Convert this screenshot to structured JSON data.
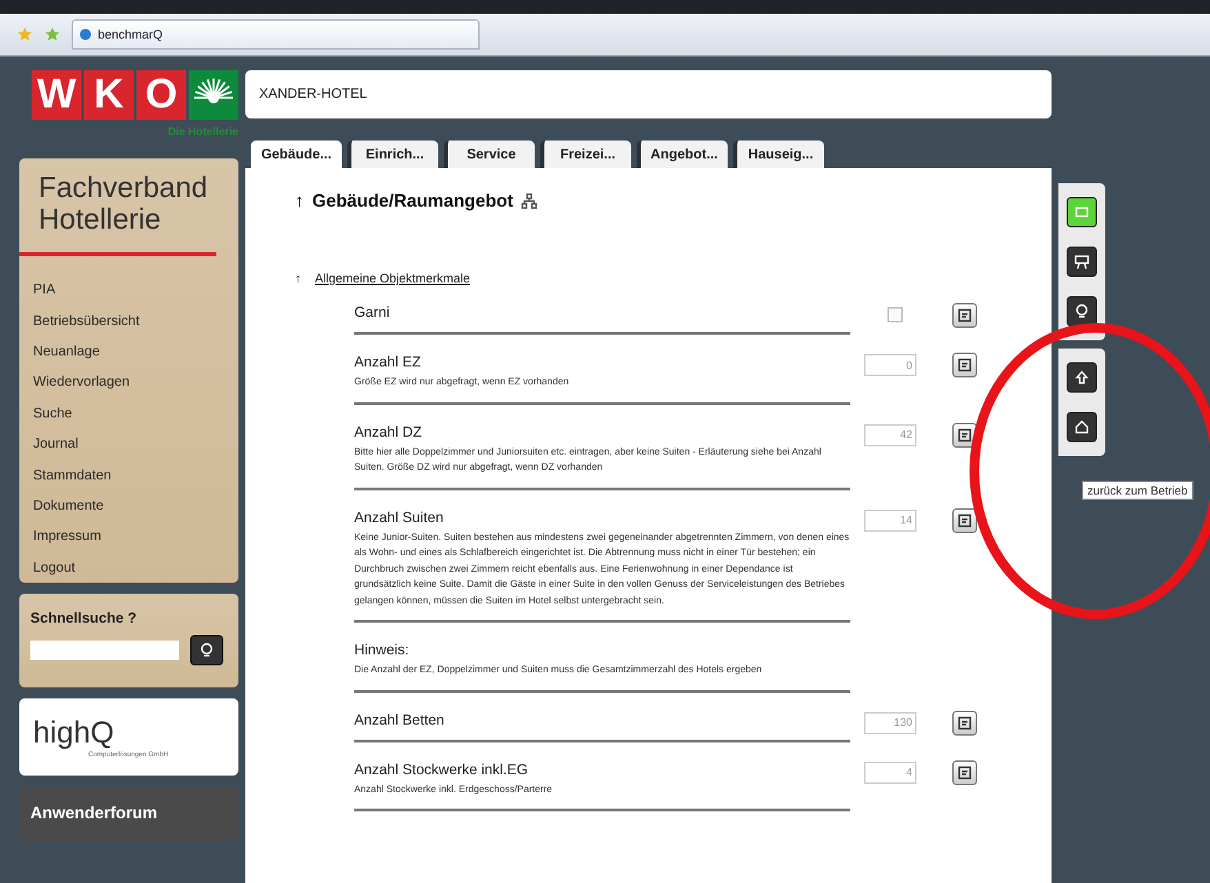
{
  "browser": {
    "tab_title": "benchmarQ"
  },
  "logo": {
    "letters": [
      "W",
      "K",
      "O"
    ],
    "subtitle": "Die Hotellerie"
  },
  "sidebar": {
    "title": "Fachverband Hotellerie",
    "items": [
      {
        "label": "PIA"
      },
      {
        "label": "Betriebsübersicht"
      },
      {
        "label": "Neuanlage"
      },
      {
        "label": "Wiedervorlagen"
      },
      {
        "label": "Suche"
      },
      {
        "label": "Journal"
      },
      {
        "label": "Stammdaten"
      },
      {
        "label": "Dokumente"
      },
      {
        "label": "Impressum"
      },
      {
        "label": "Logout"
      }
    ]
  },
  "quick_search": {
    "label": "Schnellsuche ?"
  },
  "partner": {
    "name": "highQ",
    "tagline": "Computerlösungen GmbH"
  },
  "forum": {
    "label": "Anwenderforum"
  },
  "header": {
    "title": "XANDER-HOTEL"
  },
  "tabs": [
    {
      "label": "Gebäude...",
      "selected": true
    },
    {
      "label": "Einrich...",
      "selected": false
    },
    {
      "label": "Service",
      "selected": false
    },
    {
      "label": "Freizei...",
      "selected": false
    },
    {
      "label": "Angebot...",
      "selected": false
    },
    {
      "label": "Hauseig...",
      "selected": false
    }
  ],
  "content": {
    "arrow": "↑",
    "title": "Gebäude/Raumangebot",
    "section": {
      "arrow": "↑",
      "title": "Allgemeine Objektmerkmale"
    },
    "rows": [
      {
        "kind": "checkbox",
        "label": "Garni",
        "checked": false
      },
      {
        "kind": "number",
        "label": "Anzahl EZ",
        "note": "Größe EZ wird nur abgefragt, wenn EZ vorhanden",
        "value": "0"
      },
      {
        "kind": "number",
        "label": "Anzahl DZ",
        "note": "Bitte hier alle Doppelzimmer und Juniorsuiten etc. eintragen, aber keine Suiten - Erläuterung siehe bei Anzahl Suiten. Größe DZ wird nur abgefragt, wenn DZ vorhanden",
        "value": "42"
      },
      {
        "kind": "number",
        "label": "Anzahl Suiten",
        "note": "Keine Junior-Suiten. Suiten bestehen aus mindestens zwei gegeneinander abgetrennten Zimmern, von denen eines als Wohn- und eines als Schlafbereich eingerichtet ist. Die Abtrennung muss nicht in einer Tür bestehen; ein Durchbruch zwischen zwei Zimmern reicht ebenfalls aus. Eine Ferienwohnung in einer Dependance ist grundsätzlich keine Suite. Damit die Gäste in einer Suite in den vollen Genuss der Serviceleistungen des Betriebes gelangen können, müssen die Suiten im Hotel selbst untergebracht sein.",
        "value": "14"
      },
      {
        "kind": "note",
        "label": "Hinweis:",
        "note": "Die Anzahl der EZ, Doppelzimmer und Suiten muss die Gesamtzimmerzahl des Hotels ergeben"
      },
      {
        "kind": "number",
        "label": "Anzahl Betten",
        "value": "130"
      },
      {
        "kind": "number",
        "label": "Anzahl Stockwerke inkl.EG",
        "note": "Anzahl Stockwerke inkl. Erdgeschoss/Parterre",
        "value": "4"
      }
    ]
  },
  "tooltip": "zurück zum Betrieb"
}
